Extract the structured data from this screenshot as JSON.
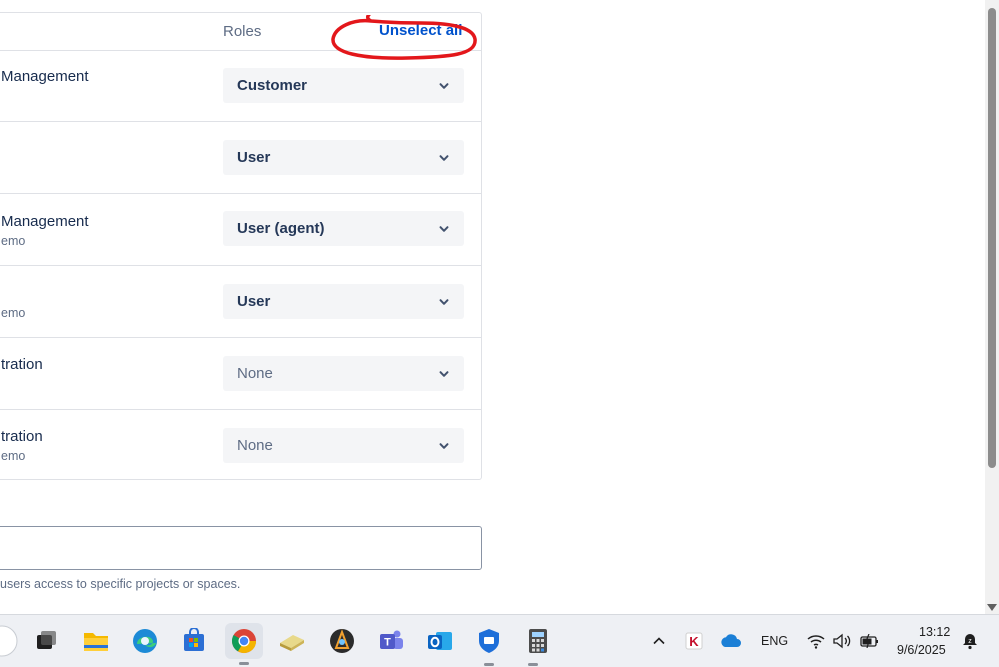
{
  "roles_table": {
    "header_label": "Roles",
    "unselect_all_label": "Unselect all",
    "rows": [
      {
        "product": "Management",
        "subtitle": "",
        "role": "Customer"
      },
      {
        "product": "",
        "subtitle": "",
        "role": "User"
      },
      {
        "product": "Management",
        "subtitle": "emo",
        "role": "User (agent)"
      },
      {
        "product": "",
        "subtitle": "emo",
        "role": "User"
      },
      {
        "product": "tration",
        "subtitle": "",
        "role": "None"
      },
      {
        "product": "tration",
        "subtitle": "emo",
        "role": "None"
      }
    ]
  },
  "group_field": {
    "value": "",
    "helper_text": "users access to specific projects or spaces."
  },
  "taskbar": {
    "apps": [
      {
        "icon": "start-partial-icon"
      },
      {
        "icon": "task-view-icon"
      },
      {
        "icon": "file-explorer-icon"
      },
      {
        "icon": "edge-browser-icon"
      },
      {
        "icon": "microsoft-store-icon"
      },
      {
        "icon": "chrome-icon"
      },
      {
        "icon": "notepad-app-icon"
      },
      {
        "icon": "krita-app-icon"
      },
      {
        "icon": "teams-icon"
      },
      {
        "icon": "outlook-icon"
      },
      {
        "icon": "shield-app-icon"
      },
      {
        "icon": "calculator-icon"
      }
    ],
    "tray": {
      "language": "ENG",
      "time": "13:12",
      "date": "9/6/2025"
    }
  },
  "colors": {
    "link": "#0052cc",
    "annotation": "#e3171b",
    "select_bg": "#f4f5f7"
  }
}
